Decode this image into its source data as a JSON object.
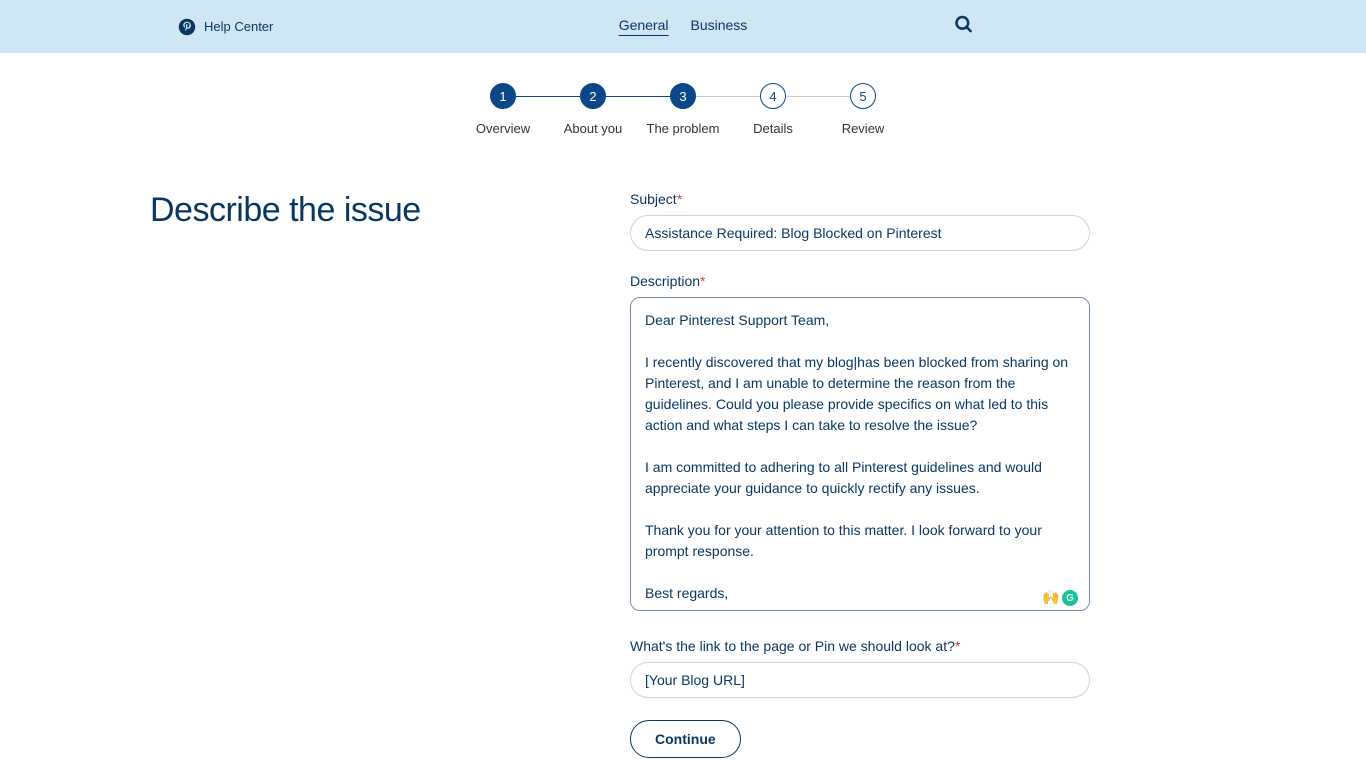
{
  "header": {
    "brand": "Help Center",
    "tabs": {
      "general": "General",
      "business": "Business"
    }
  },
  "stepper": {
    "steps": [
      {
        "num": "1",
        "label": "Overview"
      },
      {
        "num": "2",
        "label": "About you"
      },
      {
        "num": "3",
        "label": "The problem"
      },
      {
        "num": "4",
        "label": "Details"
      },
      {
        "num": "5",
        "label": "Review"
      }
    ]
  },
  "page": {
    "title": "Describe the issue"
  },
  "form": {
    "subject_label": "Subject",
    "subject_value": "Assistance Required: Blog Blocked on Pinterest",
    "description_label": "Description",
    "description_value": "Dear Pinterest Support Team,\n\nI recently discovered that my blog|has been blocked from sharing on Pinterest, and I am unable to determine the reason from the guidelines. Could you please provide specifics on what led to this action and what steps I can take to resolve the issue?\n\nI am committed to adhering to all Pinterest guidelines and would appreciate your guidance to quickly rectify any issues.\n\nThank you for your attention to this matter. I look forward to your prompt response.\n\nBest regards,",
    "link_label": "What's the link to the page or Pin we should look at?",
    "link_value": "[Your Blog URL]",
    "continue": "Continue",
    "required_mark": "*"
  }
}
